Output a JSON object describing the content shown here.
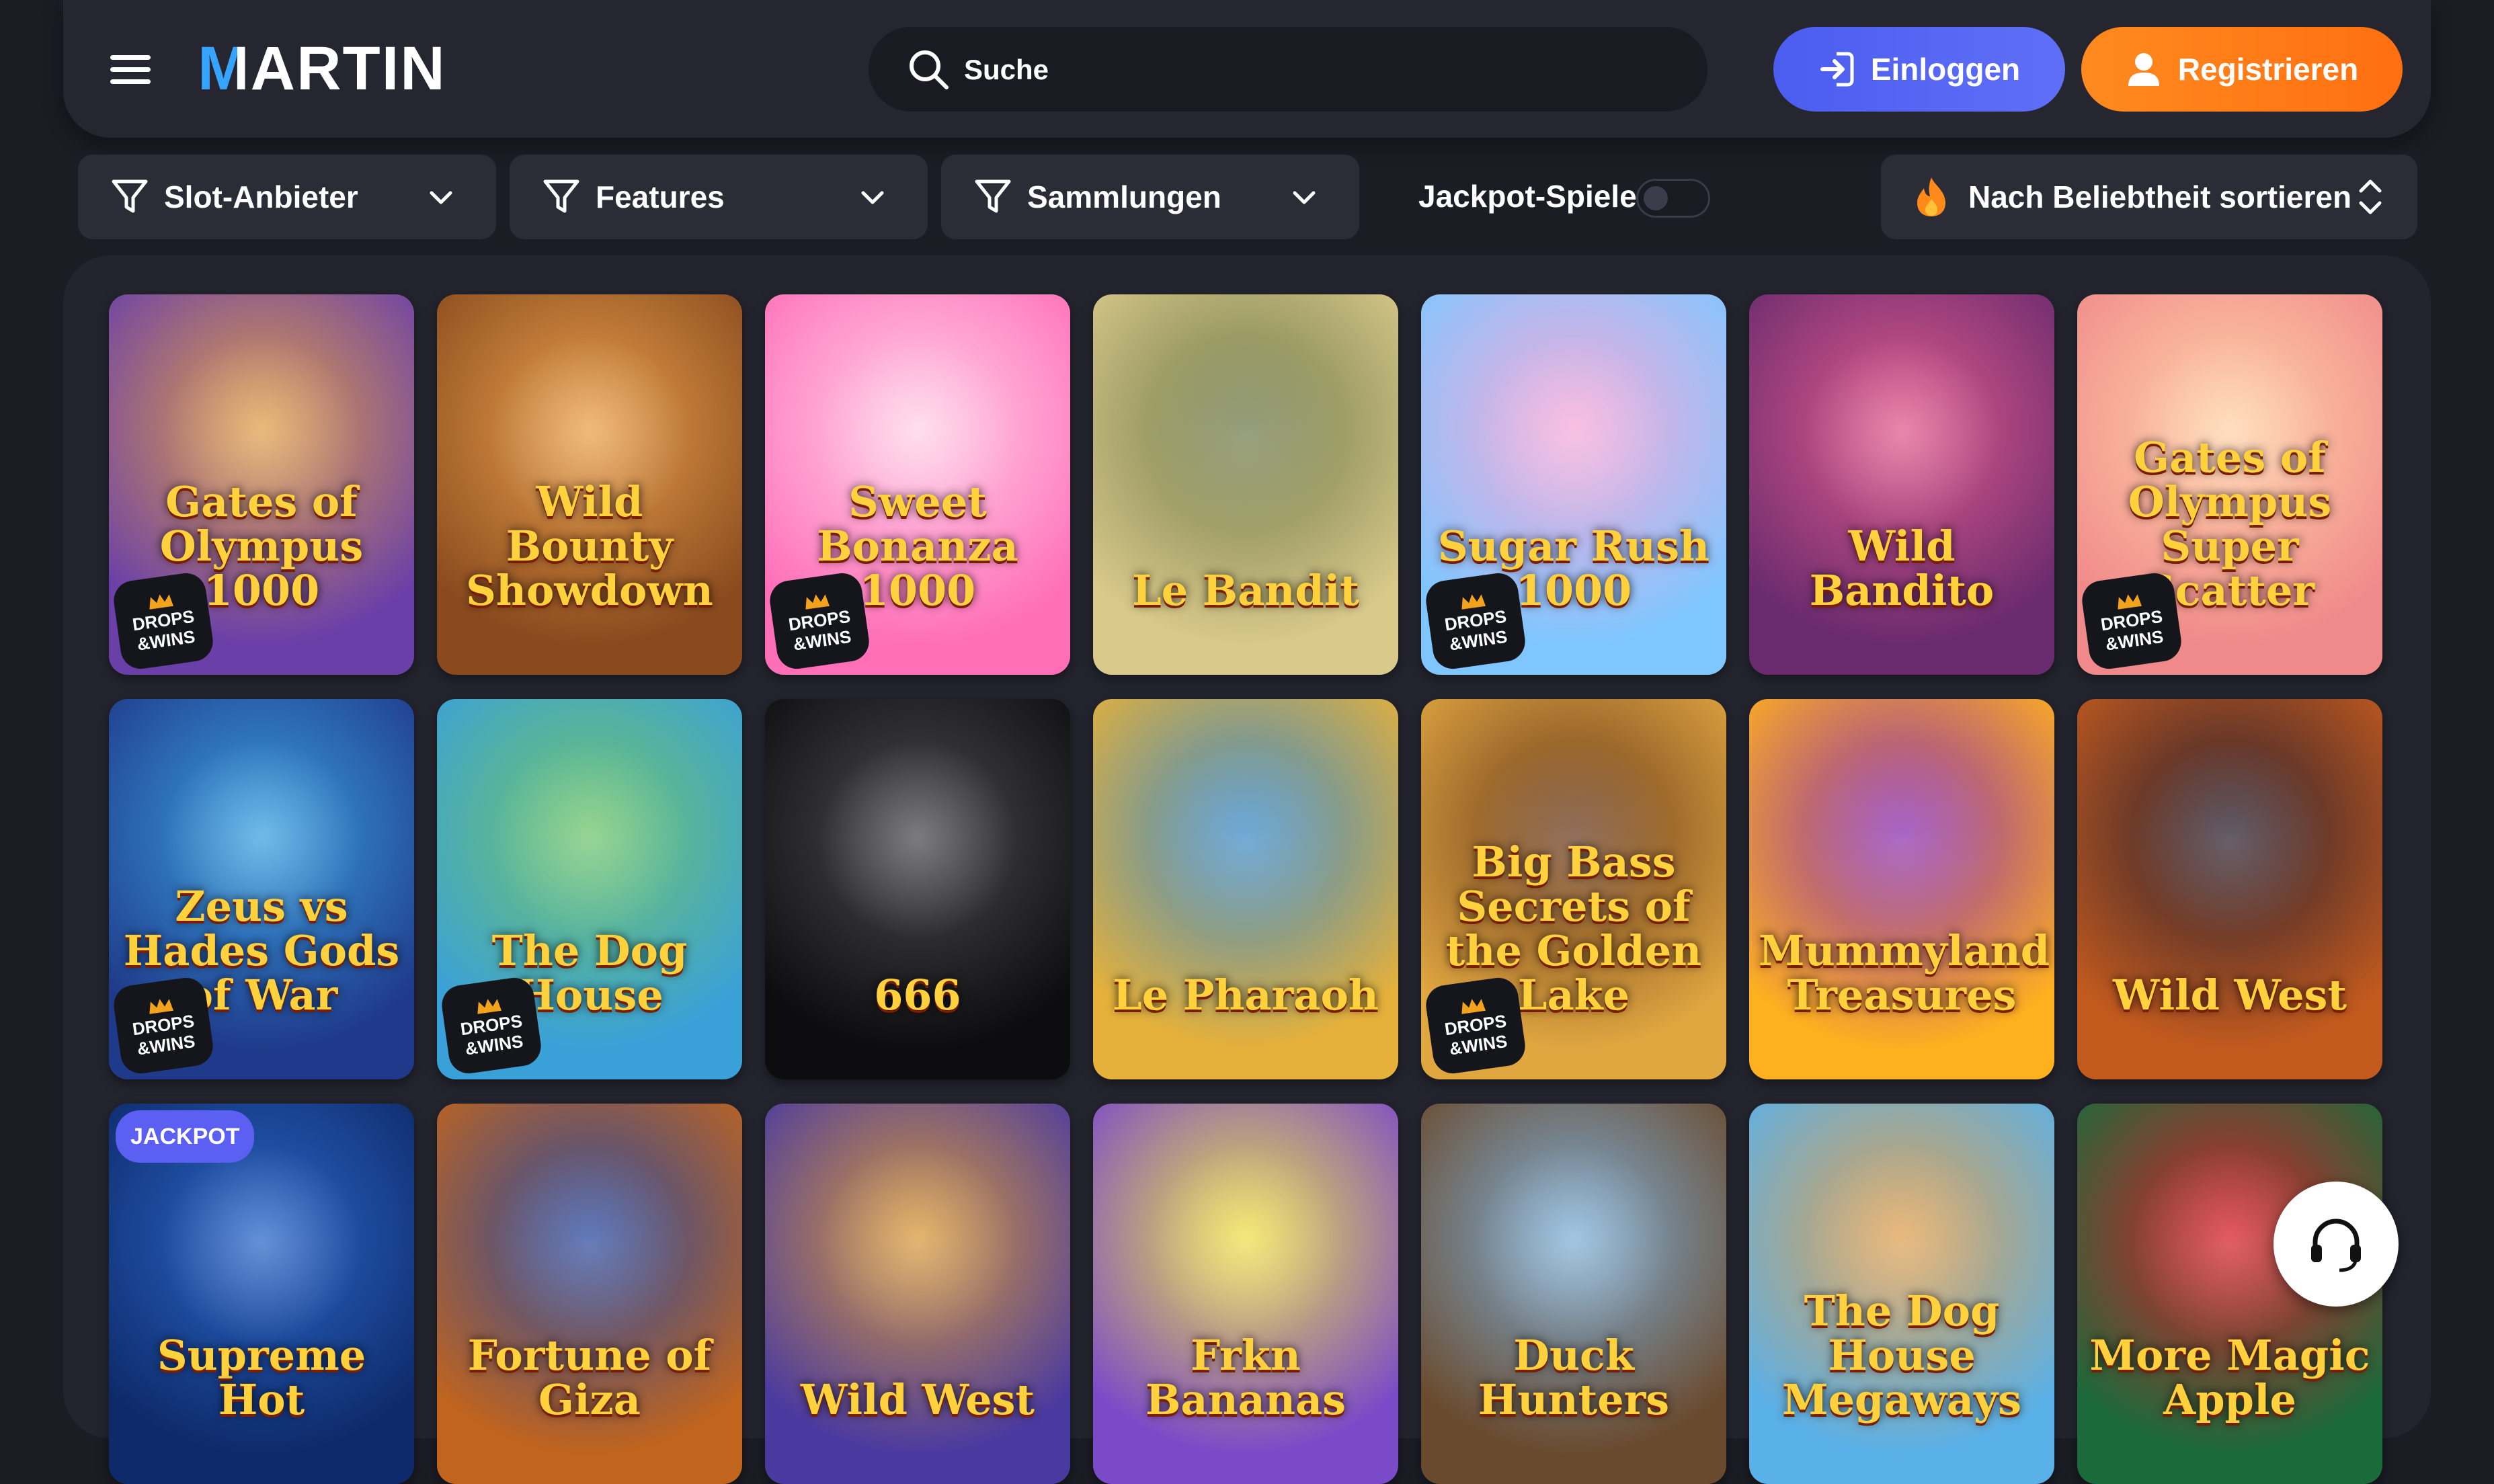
{
  "header": {
    "logo": "MARTIN",
    "search": {
      "placeholder": "Suche",
      "value": ""
    },
    "login_label": "Einloggen",
    "register_label": "Registrieren"
  },
  "filters": {
    "providers_label": "Slot-Anbieter",
    "features_label": "Features",
    "collections_label": "Sammlungen",
    "jackpot_label": "Jackpot-Spiele",
    "jackpot_enabled": false,
    "sort_label": "Nach Beliebtheit sortieren"
  },
  "badges": {
    "drops_line1": "DROPS",
    "drops_line2": "&WINS",
    "jackpot": "JACKPOT"
  },
  "games": [
    {
      "title": "Gates of Olympus 1000",
      "drops": true,
      "jackpot": false,
      "colors": [
        "#6a3fa8",
        "#e0a04a"
      ]
    },
    {
      "title": "Wild Bounty Showdown",
      "drops": false,
      "jackpot": false,
      "colors": [
        "#8a4a1e",
        "#e9a04b"
      ]
    },
    {
      "title": "Sweet Bonanza 1000",
      "drops": true,
      "jackpot": false,
      "colors": [
        "#ff6fb8",
        "#ffd1e8"
      ]
    },
    {
      "title": "Le Bandit",
      "drops": false,
      "jackpot": false,
      "colors": [
        "#d9c98a",
        "#6f7a4a"
      ]
    },
    {
      "title": "Sugar Rush 1000",
      "drops": true,
      "jackpot": false,
      "colors": [
        "#7fc6ff",
        "#f6a9d8"
      ]
    },
    {
      "title": "Wild Bandito",
      "drops": false,
      "jackpot": false,
      "colors": [
        "#6a2b6e",
        "#e05a8c"
      ]
    },
    {
      "title": "Gates of Olympus Super Scatter",
      "drops": true,
      "jackpot": false,
      "colors": [
        "#f08a8a",
        "#ffd2a8"
      ]
    },
    {
      "title": "Zeus vs Hades Gods of War",
      "drops": true,
      "jackpot": false,
      "colors": [
        "#1f3a8a",
        "#3aa0e0"
      ]
    },
    {
      "title": "The Dog House",
      "drops": true,
      "jackpot": false,
      "colors": [
        "#3aa0d8",
        "#6fc46a"
      ]
    },
    {
      "title": "666",
      "drops": false,
      "jackpot": false,
      "colors": [
        "#0d0d0f",
        "#4a4a4e"
      ]
    },
    {
      "title": "Le Pharaoh",
      "drops": false,
      "jackpot": false,
      "colors": [
        "#e6b13a",
        "#3c8ac8"
      ]
    },
    {
      "title": "Big Bass Secrets of the Golden Lake",
      "drops": true,
      "jackpot": false,
      "colors": [
        "#e0a640",
        "#6a3b1e"
      ]
    },
    {
      "title": "Mummyland Treasures",
      "drops": false,
      "jackpot": false,
      "colors": [
        "#ffb01f",
        "#8a2fb0"
      ]
    },
    {
      "title": "Wild West",
      "drops": false,
      "jackpot": false,
      "colors": [
        "#c25a1e",
        "#2a2030"
      ]
    },
    {
      "title": "Supreme Hot",
      "drops": false,
      "jackpot": true,
      "colors": [
        "#0e2a6a",
        "#2a66c8"
      ]
    },
    {
      "title": "Fortune of Giza",
      "drops": false,
      "jackpot": false,
      "colors": [
        "#c0641e",
        "#2a4aa0"
      ]
    },
    {
      "title": "Wild West",
      "drops": false,
      "jackpot": false,
      "colors": [
        "#4a3aa0",
        "#d89a3a"
      ]
    },
    {
      "title": "Frkn Bananas",
      "drops": false,
      "jackpot": false,
      "colors": [
        "#7a4ac8",
        "#f0e04a"
      ]
    },
    {
      "title": "Duck Hunters",
      "drops": false,
      "jackpot": false,
      "colors": [
        "#6a4a2e",
        "#7fb0d8"
      ]
    },
    {
      "title": "The Dog House Megaways",
      "drops": false,
      "jackpot": false,
      "colors": [
        "#5ab0e8",
        "#e0a050"
      ]
    },
    {
      "title": "More Magic Apple",
      "drops": false,
      "jackpot": false,
      "colors": [
        "#1a6a3a",
        "#d8202a"
      ]
    }
  ],
  "colors": {
    "login": "#5566f3",
    "register": "#ff7b16",
    "jackpot_badge": "#5b5ff2"
  }
}
